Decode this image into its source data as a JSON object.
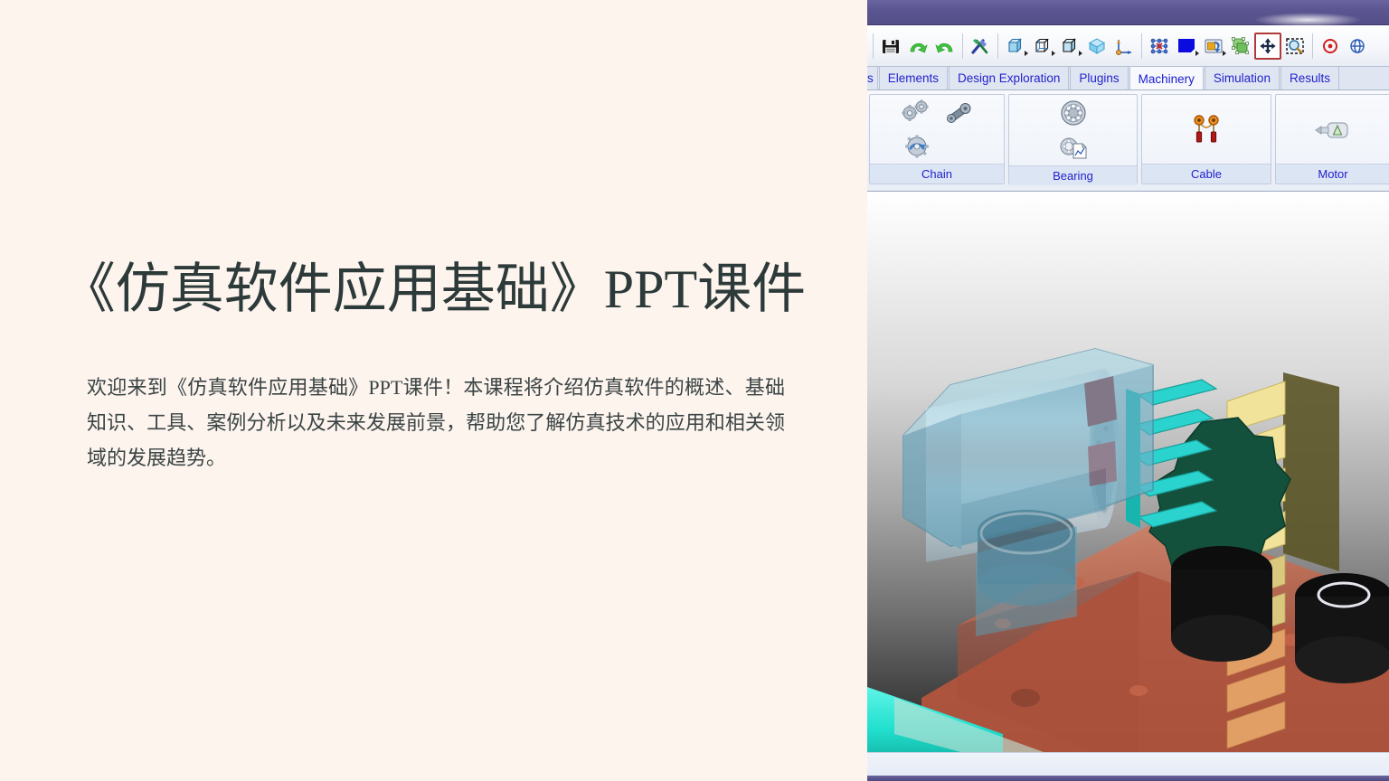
{
  "slide": {
    "title": "《仿真软件应用基础》PPT课件",
    "body": "欢迎来到《仿真软件应用基础》PPT课件！本课程将介绍仿真软件的概述、基础知识、工具、案例分析以及未来发展前景，帮助您了解仿真技术的应用和相关领域的发展趋势。",
    "background_color": "#fdf4ee",
    "title_color": "#2d3a3a",
    "body_color": "#3a4444"
  },
  "app": {
    "titlebar": {
      "color": "#5a5490"
    },
    "toolbar": {
      "buttons": [
        {
          "name": "save-icon",
          "label": "Save"
        },
        {
          "name": "redo-icon",
          "label": "Redo"
        },
        {
          "name": "undo-icon",
          "label": "Undo"
        },
        {
          "name": "tools-icon",
          "label": "Tools"
        },
        {
          "name": "solid-box-icon",
          "label": "Solid Body"
        },
        {
          "name": "wireframe-box-icon",
          "label": "Wireframe"
        },
        {
          "name": "shaded-box-icon",
          "label": "Shaded Edges"
        },
        {
          "name": "isometric-cube-icon",
          "label": "Isometric View"
        },
        {
          "name": "coordinate-axis-icon",
          "label": "Coordinate System"
        },
        {
          "name": "mesh-nodes-icon",
          "label": "Mesh Nodes"
        },
        {
          "name": "color-swatch-icon",
          "label": "Color"
        },
        {
          "name": "rotate-object-icon",
          "label": "Rotate"
        },
        {
          "name": "multi-body-icon",
          "label": "Bodies"
        },
        {
          "name": "move-icon",
          "label": "Move"
        },
        {
          "name": "zoom-box-icon",
          "label": "Zoom Window"
        },
        {
          "name": "target-icon",
          "label": "Target"
        },
        {
          "name": "orbit-icon",
          "label": "Orbit"
        }
      ],
      "selected": "move-icon",
      "swatch_color": "#0b0be0"
    },
    "tabs": [
      {
        "label": "s",
        "active": false,
        "clipped": true
      },
      {
        "label": "Elements",
        "active": false
      },
      {
        "label": "Design Exploration",
        "active": false
      },
      {
        "label": "Plugins",
        "active": false
      },
      {
        "label": "Machinery",
        "active": true
      },
      {
        "label": "Simulation",
        "active": false
      },
      {
        "label": "Results",
        "active": false
      }
    ],
    "ribbon_groups": [
      {
        "label": "Chain",
        "icons": [
          "gears-icon",
          "belt-drive-icon",
          "sprocket-icon"
        ]
      },
      {
        "label": "Bearing",
        "icons": [
          "ball-bearing-icon",
          "bearing-report-icon"
        ]
      },
      {
        "label": "Cable",
        "icons": [
          "cable-pulley-icon"
        ]
      },
      {
        "label": "Motor",
        "icons": [
          "motor-icon"
        ]
      }
    ],
    "viewport": {
      "model_name": "gear-motor-assembly",
      "background": "white-to-black vertical gradient",
      "parts": [
        {
          "name": "motor-housing",
          "color": "#7db3c9"
        },
        {
          "name": "motor-rotor-cylinder",
          "color": "#cdd8dc"
        },
        {
          "name": "red-end-cap",
          "color": "#a01818"
        },
        {
          "name": "cyan-pinion-gear",
          "color": "#25d8d8"
        },
        {
          "name": "yellow-spur-gear",
          "color": "#ecdf7f"
        },
        {
          "name": "dark-green-gear",
          "color": "#13503c"
        },
        {
          "name": "black-bushing",
          "color": "#111111"
        },
        {
          "name": "base-plate",
          "color": "#c8694f"
        },
        {
          "name": "cyan-shaft",
          "color": "#28f0e0"
        }
      ]
    }
  }
}
